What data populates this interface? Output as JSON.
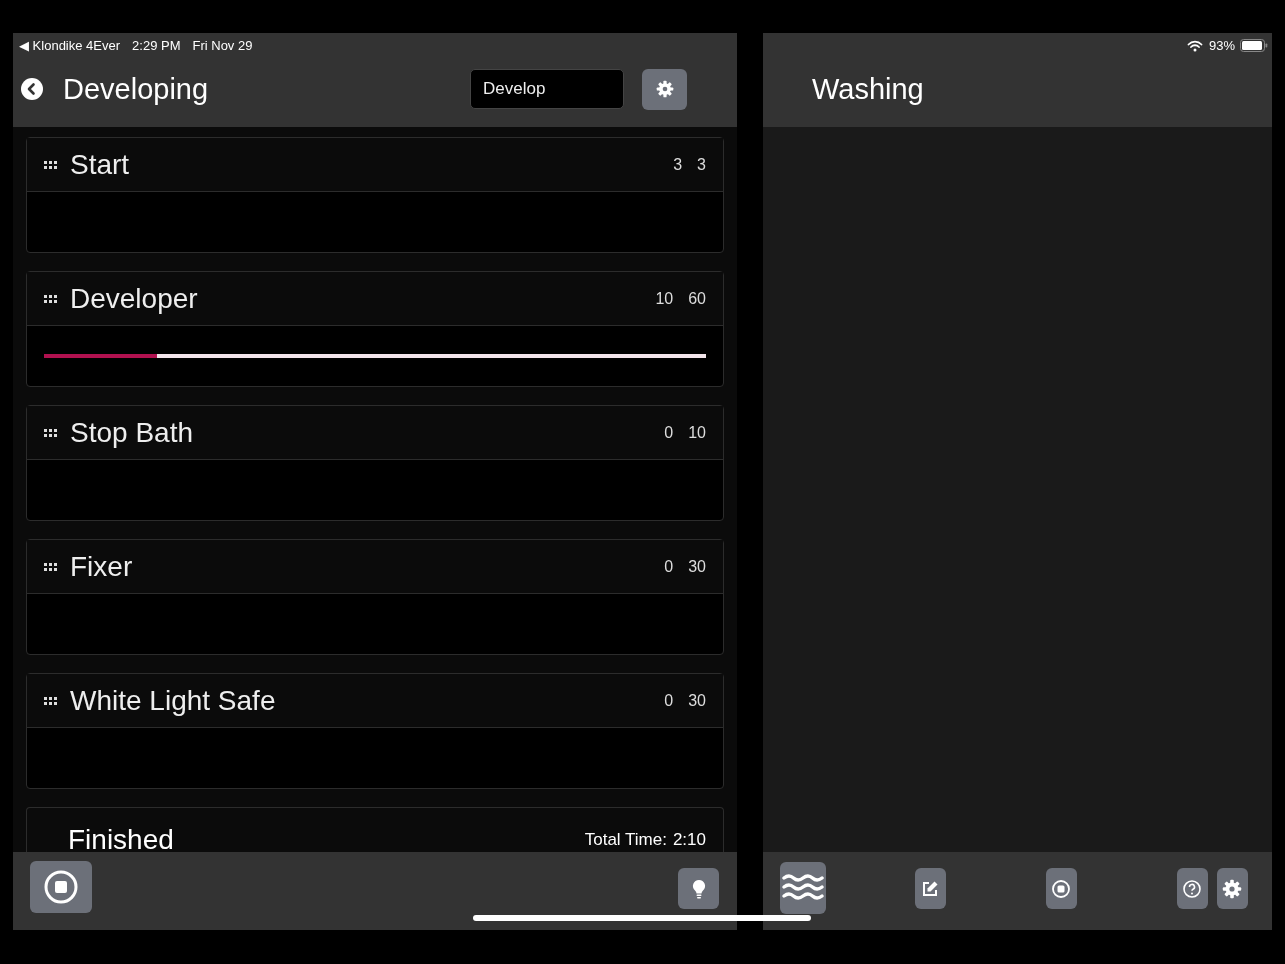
{
  "status_bar": {
    "back_app": "◀ Klondike 4Ever",
    "time": "2:29 PM",
    "date": "Fri Nov 29",
    "battery": "93%"
  },
  "left_pane": {
    "title": "Developing",
    "mode_field": {
      "value": "Develop"
    },
    "steps": [
      {
        "name": "Start",
        "count": "3",
        "duration": "3"
      },
      {
        "name": "Developer",
        "count": "10",
        "duration": "60",
        "level": 0.17
      },
      {
        "name": "Stop Bath",
        "count": "0",
        "duration": "10"
      },
      {
        "name": "Fixer",
        "count": "0",
        "duration": "30"
      },
      {
        "name": "White Light Safe",
        "count": "0",
        "duration": "30"
      }
    ],
    "finished": {
      "label": "Finished",
      "total_label": "Total Time:",
      "total_value": "2:10"
    }
  },
  "right_pane": {
    "title": "Washing"
  }
}
